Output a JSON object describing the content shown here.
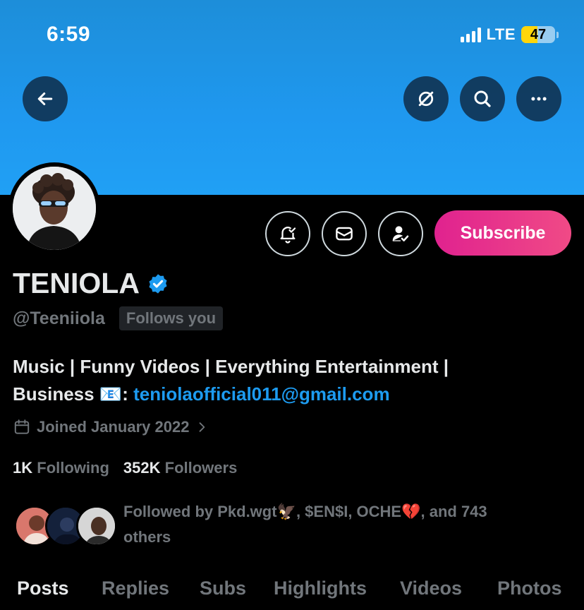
{
  "status_bar": {
    "time": "6:59",
    "network": "LTE",
    "battery": "47",
    "battery_level": 0.47
  },
  "header": {
    "back_icon": "arrow-left-icon",
    "icons": [
      "grok-icon",
      "search-icon",
      "more-icon"
    ]
  },
  "profile": {
    "name": "TENIOLA",
    "verified_icon": "verified-badge-icon",
    "handle": "@Teeniiola",
    "follows_you": "Follows you",
    "bio_line1": "Music | Funny Videos | Everything Entertainment |",
    "bio_line2_prefix": "Business 📧: ",
    "bio_email": "teniolaofficial011@gmail.com",
    "joined": "Joined January 2022",
    "following_count": "1K",
    "following_label": "Following",
    "followers_count": "352K",
    "followers_label": "Followers",
    "followed_by_line1": "Followed by Pkd.wgt🦅, $EN$I, OCHE💔, and 743",
    "followed_by_line2": "others"
  },
  "actions": {
    "subscribe_label": "Subscribe",
    "icons": [
      "notification-bell-icon",
      "message-icon",
      "following-user-icon"
    ]
  },
  "tabs": [
    "Posts",
    "Replies",
    "Subs",
    "Highlights",
    "Videos",
    "Photos"
  ],
  "colors": {
    "accent": "#1d9bf0",
    "subscribe": "#e0228f",
    "muted": "#71767b",
    "background": "#000000"
  }
}
